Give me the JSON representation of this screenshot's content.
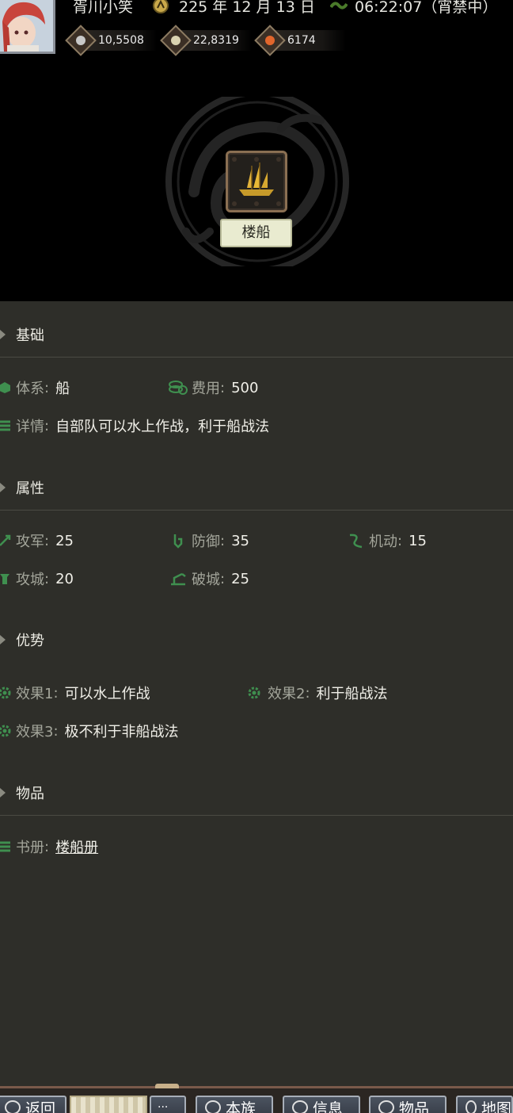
{
  "header": {
    "player_name": "胥川小笑",
    "date": "225 年 12 月 13 日",
    "time": "06:22:07（宵禁中）",
    "resources": [
      {
        "name": "silver-coin",
        "value": "10,5508",
        "color": "#c8c8c8"
      },
      {
        "name": "rice-bowl",
        "value": "22,8319",
        "color": "#d9d2b0"
      },
      {
        "name": "peach",
        "value": "6174",
        "color": "#e2662c"
      }
    ]
  },
  "unit": {
    "name": "楼船",
    "icon": "ship-icon"
  },
  "sections": {
    "basic": {
      "title": "基础",
      "system_label": "体系",
      "system_value": "船",
      "cost_label": "费用",
      "cost_value": "500",
      "detail_label": "详情",
      "detail_value": "自部队可以水上作战，利于船战法"
    },
    "attributes": {
      "title": "属性",
      "attack_label": "攻军",
      "attack_value": "25",
      "defense_label": "防御",
      "defense_value": "35",
      "mobility_label": "机动",
      "mobility_value": "15",
      "siege_label": "攻城",
      "siege_value": "20",
      "breach_label": "破城",
      "breach_value": "25"
    },
    "advantages": {
      "title": "优势",
      "effect1_label": "效果1",
      "effect1_value": "可以水上作战",
      "effect2_label": "效果2",
      "effect2_value": "利于船战法",
      "effect3_label": "效果3",
      "effect3_value": "极不利于非船战法"
    },
    "items": {
      "title": "物品",
      "book_label": "书册",
      "book_value": "楼船册"
    }
  },
  "colon": ":",
  "bottom_nav": {
    "back": "返回",
    "more": "···",
    "clan": "本族",
    "messages": "信息",
    "items": "物品",
    "map": "地图"
  },
  "colors": {
    "header_bg": "#000000",
    "content_bg": "#2e2e29",
    "label_gray": "#a3a59a",
    "link_green": "#7fd04a",
    "icon_green": "#3f8f4f"
  }
}
